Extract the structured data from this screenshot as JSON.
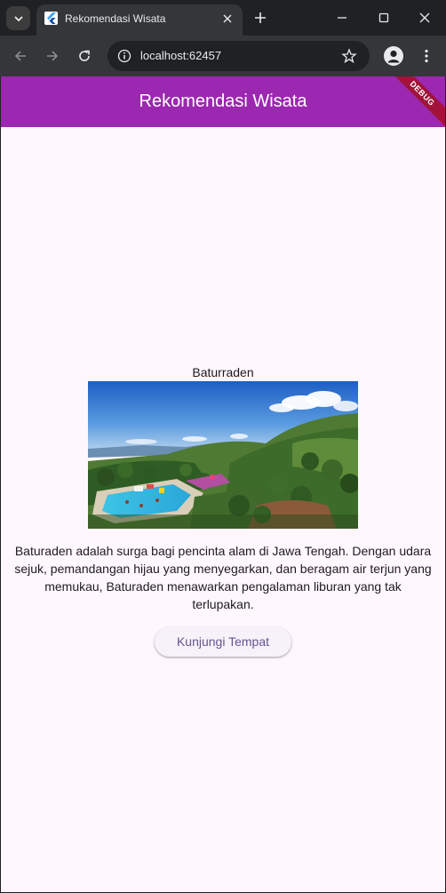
{
  "browser": {
    "tab_title": "Rekomendasi Wisata",
    "url": "localhost:62457"
  },
  "app": {
    "title": "Rekomendasi Wisata",
    "debug_label": "DEBUG",
    "theme_color": "#9c27b0"
  },
  "place": {
    "name": "Baturraden",
    "description": "Baturaden adalah surga bagi pencinta alam di Jawa Tengah. Dengan udara sejuk, pemandangan hijau yang menyegarkan, dan beragam air terjun yang memukau, Baturaden menawarkan pengalaman liburan yang tak terlupakan.",
    "button_label": "Kunjungi Tempat"
  }
}
